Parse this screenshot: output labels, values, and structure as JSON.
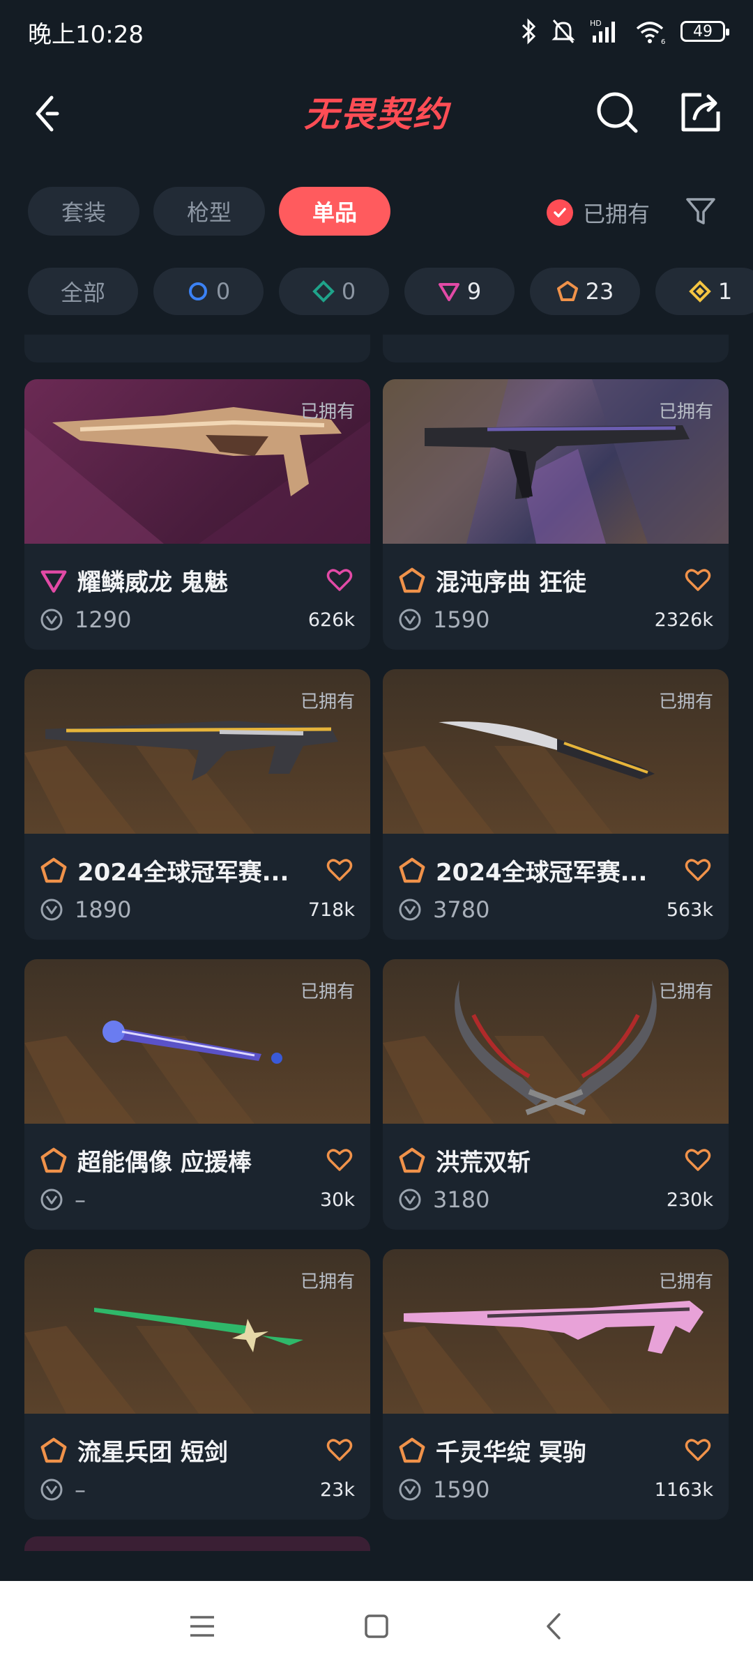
{
  "status_bar": {
    "time": "晚上10:28",
    "battery": "49",
    "network": "HD",
    "wifi_badge": "6"
  },
  "header": {
    "title": "无畏契约"
  },
  "tabs": [
    {
      "label": "套装",
      "active": false
    },
    {
      "label": "枪型",
      "active": false
    },
    {
      "label": "单品",
      "active": true
    }
  ],
  "owned_filter": {
    "label": "已拥有",
    "checked": true
  },
  "rarity_chips": [
    {
      "label": "全部"
    },
    {
      "count": "0",
      "icon": "select-tier-icon",
      "color": "#3b82f6"
    },
    {
      "count": "0",
      "icon": "deluxe-tier-icon",
      "color": "#1fa38a"
    },
    {
      "count": "9",
      "icon": "premium-tier-icon",
      "color": "#e24aa6"
    },
    {
      "count": "23",
      "icon": "exclusive-tier-icon",
      "color": "#f0924a"
    },
    {
      "count": "1",
      "icon": "ultra-tier-icon",
      "color": "#f5c542"
    }
  ],
  "cards": [
    {
      "name": "耀鳞威龙 鬼魅",
      "tier": "premium",
      "owned": "已拥有",
      "price": "1290",
      "likes": "626k",
      "heart_color": "#e24aa6"
    },
    {
      "name": "混沌序曲 狂徒",
      "tier": "exclusive",
      "owned": "已拥有",
      "price": "1590",
      "likes": "2326k",
      "heart_color": "#f0924a"
    },
    {
      "name": "2024全球冠军赛...",
      "tier": "exclusive",
      "owned": "已拥有",
      "price": "1890",
      "likes": "718k",
      "heart_color": "#f0924a"
    },
    {
      "name": "2024全球冠军赛...",
      "tier": "exclusive",
      "owned": "已拥有",
      "price": "3780",
      "likes": "563k",
      "heart_color": "#f0924a"
    },
    {
      "name": "超能偶像 应援棒",
      "tier": "exclusive",
      "owned": "已拥有",
      "price": "–",
      "likes": "30k",
      "heart_color": "#f0924a"
    },
    {
      "name": "洪荒双斩",
      "tier": "exclusive",
      "owned": "已拥有",
      "price": "3180",
      "likes": "230k",
      "heart_color": "#f0924a"
    },
    {
      "name": "流星兵团 短剑",
      "tier": "exclusive",
      "owned": "已拥有",
      "price": "–",
      "likes": "23k",
      "heart_color": "#f0924a"
    },
    {
      "name": "千灵华绽 冥驹",
      "tier": "exclusive",
      "owned": "已拥有",
      "price": "1590",
      "likes": "1163k",
      "heart_color": "#f0924a"
    }
  ],
  "colors": {
    "accent": "#ff5b5e",
    "background": "#141c24",
    "card": "#1b242e"
  }
}
